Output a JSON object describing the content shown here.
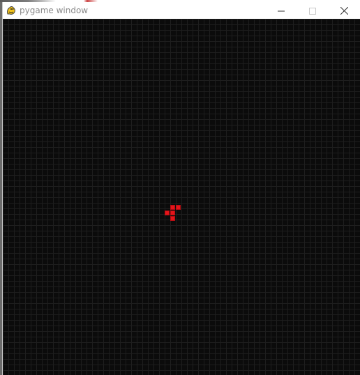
{
  "window": {
    "title": "pygame window",
    "icon": "pygame-snake-icon",
    "controls": [
      "minimize-icon",
      "maximize-icon",
      "close-icon"
    ]
  },
  "game": {
    "background_color": "#0b0b0b",
    "grid_color": "#1e1e1e",
    "cell_color": "#e4141a"
  }
}
